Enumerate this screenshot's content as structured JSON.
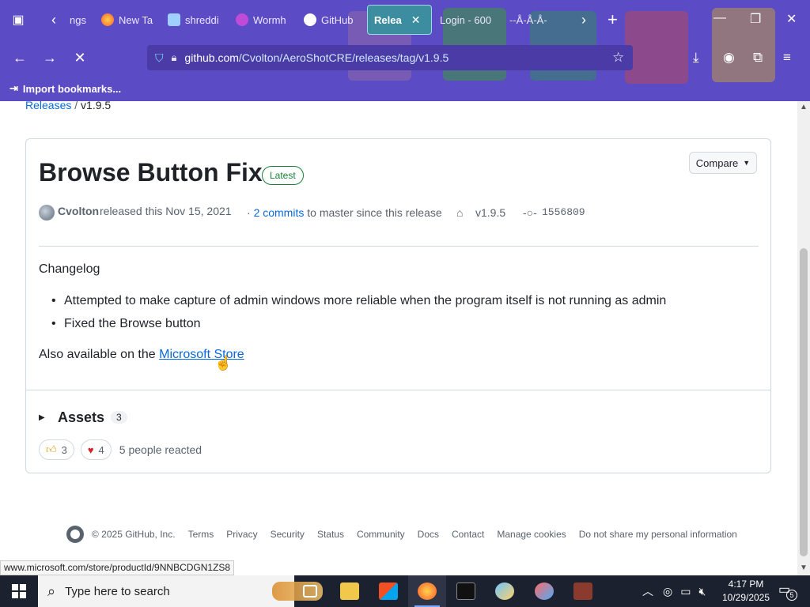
{
  "browser": {
    "tabs": [
      {
        "label": "ngs",
        "favicon": "generic",
        "active": false
      },
      {
        "label": "New Ta",
        "favicon": "firefox",
        "active": false
      },
      {
        "label": "shreddi",
        "favicon": "s-logo",
        "active": false
      },
      {
        "label": "Wormh",
        "favicon": "purple-circle",
        "active": false
      },
      {
        "label": "GitHub",
        "favicon": "github",
        "active": false
      },
      {
        "label": "Relea",
        "favicon": "github",
        "active": true
      },
      {
        "label": "Login - 600",
        "favicon": "generic",
        "active": false
      },
      {
        "label": "--Å-Å-Å-",
        "favicon": "generic",
        "active": false
      }
    ],
    "url_domain": "github.com",
    "url_path": "/Cvolton/AeroShotCRE/releases/tag/v1.9.5",
    "bookmark_label": "Import bookmarks...",
    "accent": "#5b4bc4"
  },
  "page": {
    "breadcrumb": {
      "parent": "Releases",
      "sep": "/",
      "current": "v1.9.5"
    },
    "release": {
      "title": "Browse Button Fix",
      "badge": "Latest",
      "compare_label": "Compare",
      "author": "Cvolton",
      "released_text": "released this Nov 15, 2021",
      "commits_prefix": "·",
      "commits_link": "2 commits",
      "commits_suffix": "to master since this release",
      "tag": "v1.9.5",
      "sha": "1556809"
    },
    "body": {
      "heading": "Changelog",
      "items": [
        "Attempted to make capture of admin windows more reliable when the program itself is not running as admin",
        "Fixed the Browse button"
      ],
      "also_prefix": "Also available on the",
      "also_link": "Microsoft Store"
    },
    "assets": {
      "label": "Assets",
      "count": "3"
    },
    "reactions": {
      "thumbs_up": "3",
      "heart": "4",
      "summary": "5 people reacted"
    },
    "footer": {
      "copyright": "© 2025 GitHub, Inc.",
      "links": [
        "Terms",
        "Privacy",
        "Security",
        "Status",
        "Community",
        "Docs",
        "Contact",
        "Manage cookies",
        "Do not share my personal information"
      ]
    },
    "status_url": "www.microsoft.com/store/productId/9NNBCDGN1ZS8"
  },
  "taskbar": {
    "search_placeholder": "Type here to search",
    "time": "4:17 PM",
    "date": "10/29/2025",
    "notification_count": "5"
  }
}
